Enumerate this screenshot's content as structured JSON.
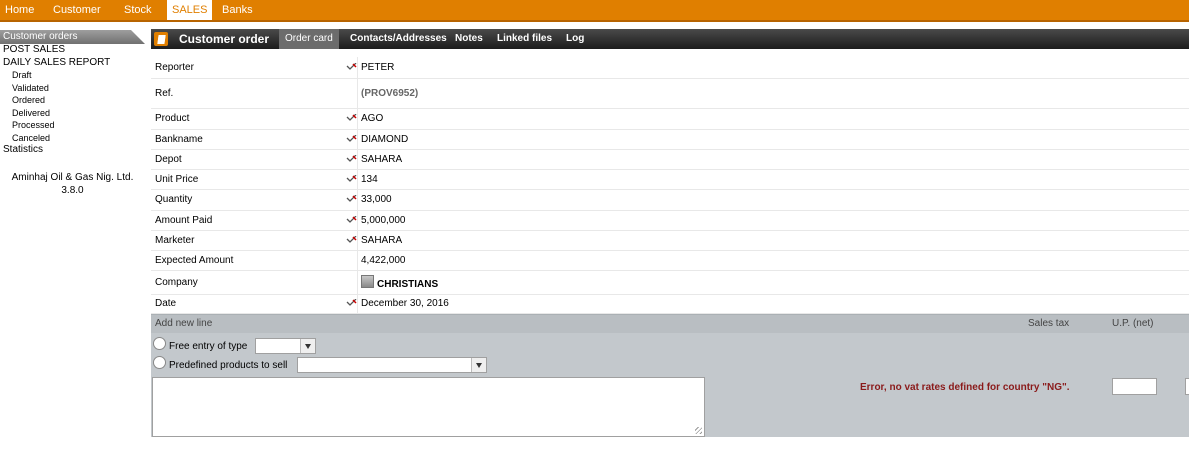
{
  "topnav": [
    {
      "label": "Home",
      "active": false
    },
    {
      "label": "Customer",
      "active": false
    },
    {
      "label": "Stock",
      "active": false
    },
    {
      "label": "SALES",
      "active": true
    },
    {
      "label": "Banks",
      "active": false
    }
  ],
  "leftmenu": {
    "header": "Customer orders",
    "post_sales": "POST SALES",
    "daily_report": "DAILY SALES REPORT",
    "sub": [
      "Draft",
      "Validated",
      "Ordered",
      "Delivered",
      "Processed",
      "Canceled"
    ],
    "statistics": "Statistics",
    "company": "Aminhaj Oil & Gas Nig. Ltd. 3.8.0"
  },
  "card": {
    "title": "Customer order",
    "tabs": [
      {
        "label": "Order card",
        "active": true
      },
      {
        "label": "Contacts/Addresses",
        "active": false
      },
      {
        "label": "Notes",
        "active": false
      },
      {
        "label": "Linked files",
        "active": false
      },
      {
        "label": "Log",
        "active": false
      }
    ]
  },
  "fields": {
    "reporter": {
      "label": "Reporter",
      "value": "PETER"
    },
    "ref": {
      "label": "Ref.",
      "value": "(PROV6952)"
    },
    "product": {
      "label": "Product",
      "value": "AGO"
    },
    "bankname": {
      "label": "Bankname",
      "value": "DIAMOND"
    },
    "depot": {
      "label": "Depot",
      "value": "SAHARA"
    },
    "unit_price": {
      "label": "Unit Price",
      "value": "134"
    },
    "quantity": {
      "label": "Quantity",
      "value": "33,000"
    },
    "amount_paid": {
      "label": "Amount Paid",
      "value": "5,000,000"
    },
    "marketer": {
      "label": "Marketer",
      "value": "SAHARA"
    },
    "expected_amount": {
      "label": "Expected Amount",
      "value": "4,422,000"
    },
    "company": {
      "label": "Company",
      "value": "CHRISTIANS"
    },
    "date": {
      "label": "Date",
      "value": "December 30, 2016"
    }
  },
  "addline": {
    "header": "Add new line",
    "sales_tax": "Sales tax",
    "up_net": "U.P. (net)",
    "free_entry": "Free entry of type",
    "predefined": "Predefined products to sell",
    "error": "Error, no vat rates defined for country \"NG\"."
  },
  "colors": {
    "accent": "#e07f00",
    "error": "#8a1a1a"
  },
  "icons": [
    "pencil-icon",
    "company-icon",
    "order-icon"
  ]
}
